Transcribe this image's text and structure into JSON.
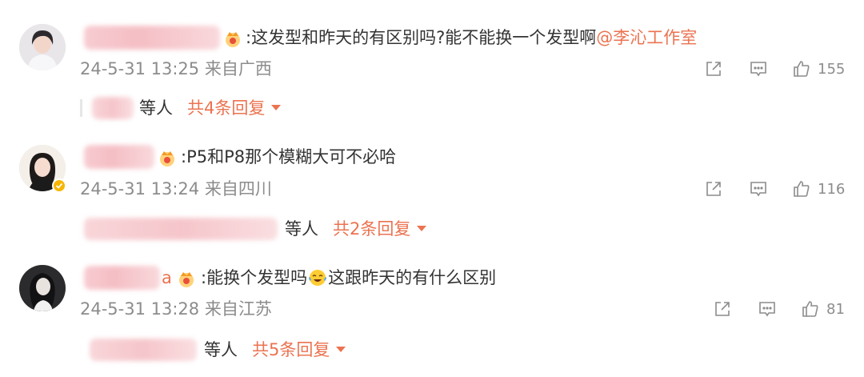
{
  "colors": {
    "accent": "#eb7350",
    "meta_gray": "#8c8c8c",
    "text": "#333333"
  },
  "comments": [
    {
      "username_suffix": "",
      "badge_icon": "crown-badge-icon",
      "text": ":这发型和昨天的有区别吗?能不能换一个发型啊",
      "mention": "@李沁工作室",
      "meta": "24-5-31 13:25 来自广西",
      "like_count": "155",
      "reply_etc": "等人",
      "reply_count": "共4条回复"
    },
    {
      "username_suffix": "",
      "badge_icon": "crown-badge-icon",
      "text": ":P5和P8那个模糊大可不必哈",
      "mention": "",
      "meta": "24-5-31 13:24 来自四川",
      "like_count": "116",
      "reply_etc": "等人",
      "reply_count": "共2条回复"
    },
    {
      "username_suffix": "a",
      "badge_icon": "crown-badge-icon",
      "text_before_emoji": ":能换个发型吗",
      "text_after_emoji": "这跟昨天的有什么区别",
      "meta": "24-5-31 13:28 来自江苏",
      "like_count": "81",
      "reply_etc": "等人",
      "reply_count": "共5条回复"
    }
  ]
}
